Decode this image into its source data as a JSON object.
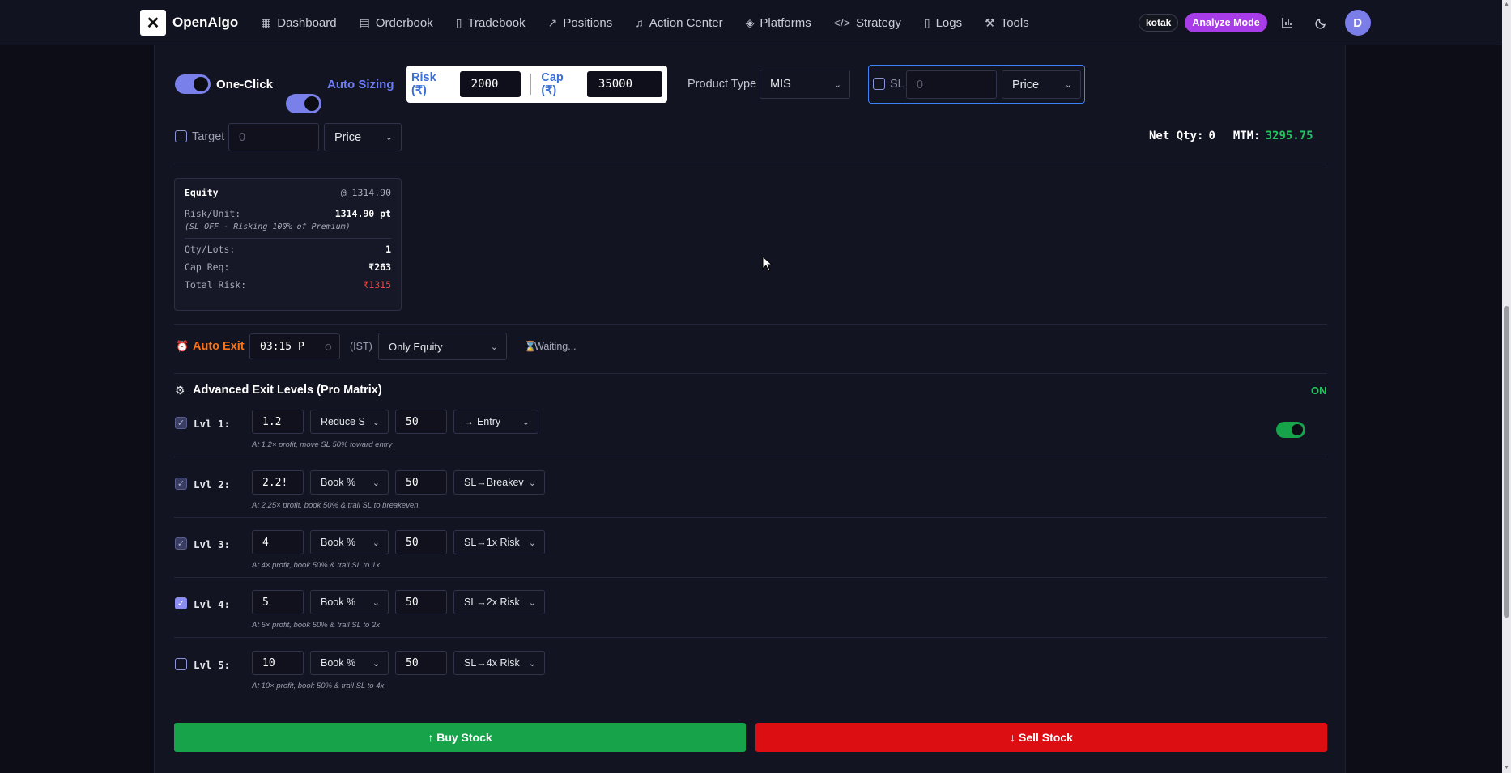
{
  "navbar": {
    "brand": "OpenAlgo",
    "items": [
      {
        "label": "Dashboard",
        "icon": "grid-icon"
      },
      {
        "label": "Orderbook",
        "icon": "clipboard-icon"
      },
      {
        "label": "Tradebook",
        "icon": "file-icon"
      },
      {
        "label": "Positions",
        "icon": "trend-icon"
      },
      {
        "label": "Action Center",
        "icon": "bell-icon"
      },
      {
        "label": "Platforms",
        "icon": "layers-icon"
      },
      {
        "label": "Strategy",
        "icon": "code-icon"
      },
      {
        "label": "Logs",
        "icon": "doc-icon"
      },
      {
        "label": "Tools",
        "icon": "wrench-icon"
      }
    ],
    "broker": "kotak",
    "mode": "Analyze Mode",
    "avatar": "D"
  },
  "controls": {
    "one_click": "One-Click",
    "auto_sizing": "Auto Sizing",
    "risk_label": "Risk (₹)",
    "risk_value": "2000",
    "cap_label": "Cap (₹)",
    "cap_value": "35000",
    "product_type_label": "Product Type",
    "product_type": "MIS",
    "sl_label": "SL",
    "sl_placeholder": "0",
    "sl_mode": "Price",
    "target_label": "Target",
    "target_placeholder": "0",
    "target_mode": "Price",
    "net_qty_label": "Net Qty:",
    "net_qty": "0",
    "mtm_label": "MTM:",
    "mtm": "3295.75"
  },
  "equity_card": {
    "title": "Equity",
    "price": "@ 1314.90",
    "risk_unit_label": "Risk/Unit:",
    "risk_unit": "1314.90 pt",
    "note": "(SL OFF - Risking 100% of Premium)",
    "qty_label": "Qty/Lots:",
    "qty": "1",
    "cap_req_label": "Cap Req:",
    "cap_req": "₹263",
    "total_risk_label": "Total Risk:",
    "total_risk": "₹1315"
  },
  "auto_exit": {
    "label": "Auto Exit",
    "time": "03:15 P",
    "tz": "(IST)",
    "scope": "Only Equity",
    "status": "Waiting..."
  },
  "advanced": {
    "title": "Advanced Exit Levels (Pro Matrix)",
    "toggle_label": "ON",
    "levels": [
      {
        "label": "Lvl 1:",
        "mult": "1.2",
        "action": "Reduce S",
        "pct": "50",
        "trail": "→ Entry",
        "hint": "At 1.2× profit, move SL 50% toward entry",
        "state": "dim"
      },
      {
        "label": "Lvl 2:",
        "mult": "2.2!",
        "action": "Book %",
        "pct": "50",
        "trail": "SL→Breakev",
        "hint": "At 2.25× profit, book 50% & trail SL to breakeven",
        "state": "dim"
      },
      {
        "label": "Lvl 3:",
        "mult": "4",
        "action": "Book %",
        "pct": "50",
        "trail": "SL→1x Risk",
        "hint": "At 4× profit, book 50% & trail SL to 1x",
        "state": "dim"
      },
      {
        "label": "Lvl 4:",
        "mult": "5",
        "action": "Book %",
        "pct": "50",
        "trail": "SL→2x Risk",
        "hint": "At 5× profit, book 50% & trail SL to 2x",
        "state": "checked"
      },
      {
        "label": "Lvl 5:",
        "mult": "10",
        "action": "Book %",
        "pct": "50",
        "trail": "SL→4x Risk",
        "hint": "At 10× profit, book 50% & trail SL to 4x",
        "state": "unchecked"
      }
    ]
  },
  "actions": {
    "buy": "↑ Buy Stock",
    "sell": "↓ Sell Stock"
  },
  "colors": {
    "accent": "#7a80ea",
    "buy": "#16a34a",
    "sell": "#dc0e12",
    "mtm_positive": "#22c55e",
    "auto_exit": "#f97316"
  }
}
